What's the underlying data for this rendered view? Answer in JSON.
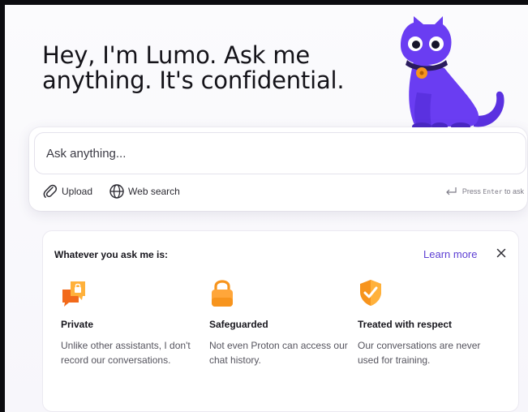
{
  "hero": {
    "title_line1": "Hey, I'm Lumo. Ask me",
    "title_line2": "anything. It's confidential."
  },
  "composer": {
    "placeholder": "Ask anything...",
    "upload_label": "Upload",
    "web_search_label": "Web search",
    "press_prefix": "Press",
    "press_key": "Enter",
    "press_suffix": "to ask"
  },
  "info_card": {
    "title": "Whatever you ask me is:",
    "learn_more": "Learn more",
    "features": [
      {
        "icon": "private-chat-icon",
        "title": "Private",
        "description": "Unlike other assistants, I don't record our conversations."
      },
      {
        "icon": "padlock-icon",
        "title": "Safeguarded",
        "description": "Not even Proton can access our chat history."
      },
      {
        "icon": "shield-check-icon",
        "title": "Treated with respect",
        "description": "Our conversations are never used for training."
      }
    ]
  },
  "colors": {
    "accent": "#5d3fd3",
    "mascot": "#6a3df2",
    "icon_orange": "#f7941d"
  }
}
